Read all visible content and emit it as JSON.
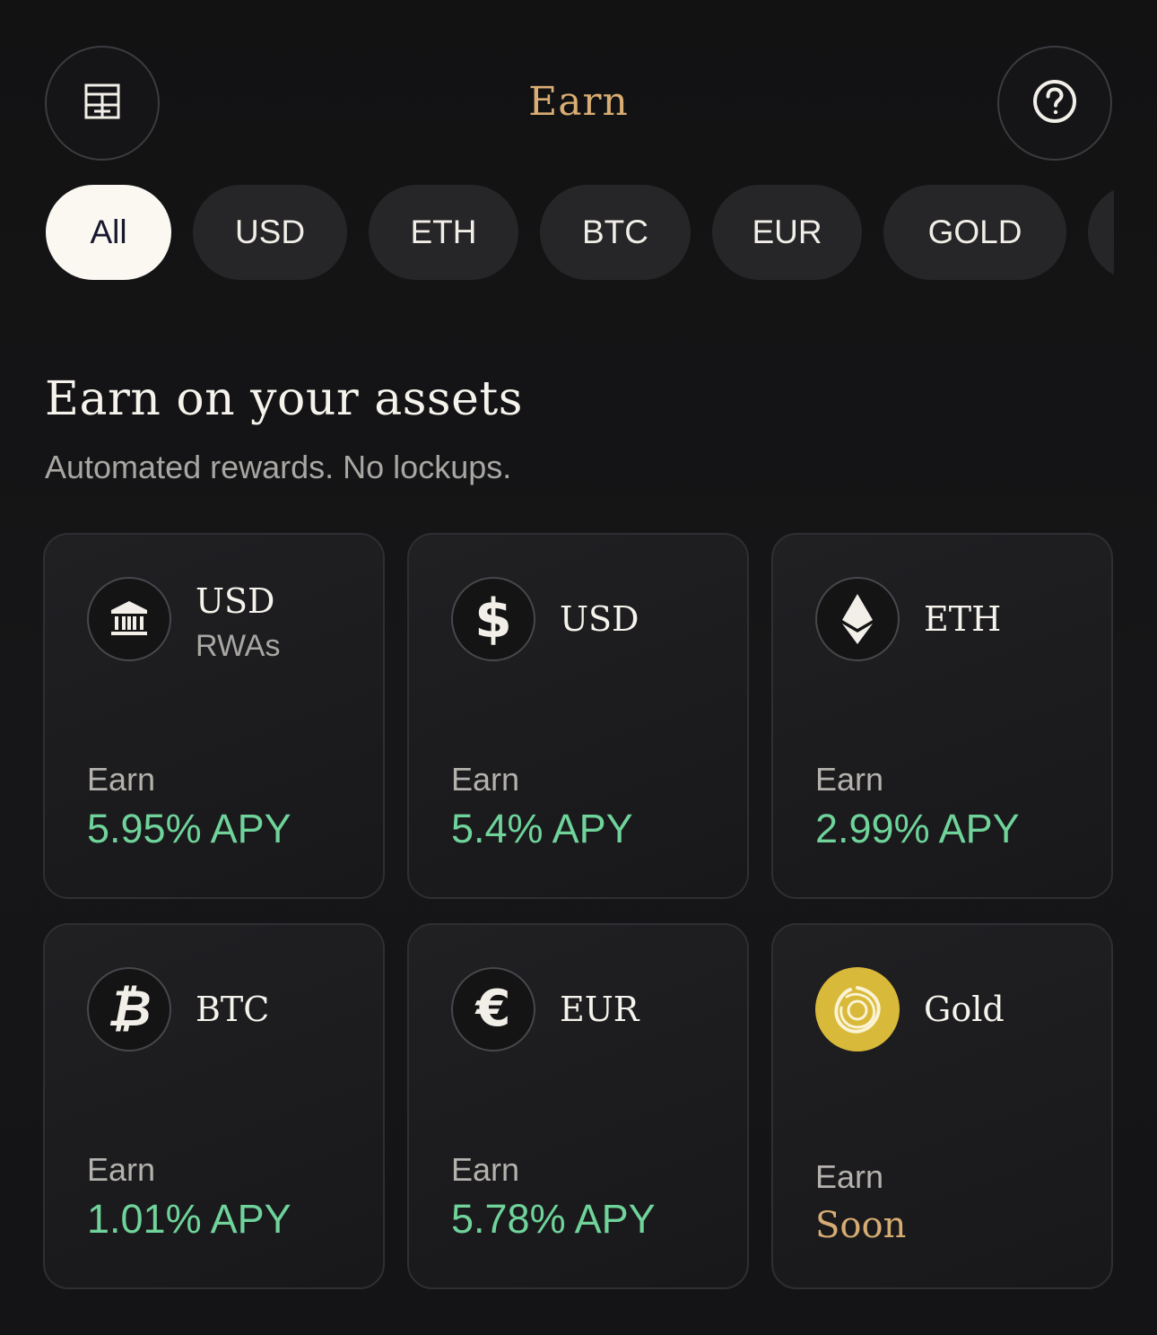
{
  "header": {
    "title": "Earn",
    "menu_icon": "ledger-grid-icon",
    "help_icon": "question-circle-icon"
  },
  "filters": [
    {
      "label": "All",
      "active": true
    },
    {
      "label": "USD",
      "active": false
    },
    {
      "label": "ETH",
      "active": false
    },
    {
      "label": "BTC",
      "active": false
    },
    {
      "label": "EUR",
      "active": false
    },
    {
      "label": "GOLD",
      "active": false
    },
    {
      "label": "",
      "active": false
    }
  ],
  "section": {
    "title": "Earn on your assets",
    "subtitle": "Automated rewards. No lockups."
  },
  "cards": [
    {
      "name": "USD",
      "sub": "RWAs",
      "icon": "bank-icon",
      "earn_label": "Earn",
      "rate": "5.95% APY"
    },
    {
      "name": "USD",
      "sub": "",
      "icon": "dollar-icon",
      "earn_label": "Earn",
      "rate": "5.4% APY"
    },
    {
      "name": "ETH",
      "sub": "",
      "icon": "ethereum-icon",
      "earn_label": "Earn",
      "rate": "2.99% APY"
    },
    {
      "name": "BTC",
      "sub": "",
      "icon": "bitcoin-icon",
      "earn_label": "Earn",
      "rate": "1.01% APY"
    },
    {
      "name": "EUR",
      "sub": "",
      "icon": "euro-icon",
      "earn_label": "Earn",
      "rate": "5.78% APY"
    },
    {
      "name": "Gold",
      "sub": "",
      "icon": "gold-coin-icon",
      "earn_label": "Earn",
      "rate": "Soon"
    }
  ],
  "colors": {
    "accent_gold": "#d9ad73",
    "apy_green": "#6fd39a",
    "chip_active_bg": "#faf8f1",
    "gold_coin": "#d8b93a"
  }
}
